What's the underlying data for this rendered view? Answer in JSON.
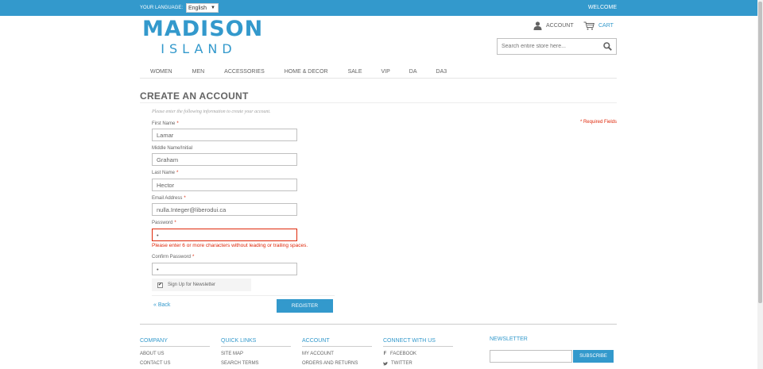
{
  "topbar": {
    "language_label": "YOUR LANGUAGE:",
    "language_value": "English",
    "welcome": "WELCOME"
  },
  "logo": {
    "line1": "MADISON",
    "line2": "ISLAND"
  },
  "header": {
    "account": "ACCOUNT",
    "cart": "CART",
    "search_placeholder": "Search entire store here..."
  },
  "nav": {
    "items": [
      {
        "label": "WOMEN"
      },
      {
        "label": "MEN"
      },
      {
        "label": "ACCESSORIES"
      },
      {
        "label": "HOME & DECOR"
      },
      {
        "label": "SALE"
      },
      {
        "label": "VIP"
      },
      {
        "label": "DA"
      },
      {
        "label": "DA3"
      }
    ]
  },
  "form": {
    "title": "CREATE AN ACCOUNT",
    "intro": "Please enter the following information to create your account.",
    "required_note": "* Required Fields",
    "required_mark": "*",
    "fields": {
      "first_name": {
        "label": "First Name",
        "value": "Lamar"
      },
      "middle_name": {
        "label": "Middle Name/Initial",
        "value": "Graham"
      },
      "last_name": {
        "label": "Last Name",
        "value": "Hector"
      },
      "email": {
        "label": "Email Address",
        "value": "nulla.Integer@liberodui.ca"
      },
      "password": {
        "label": "Password",
        "value": "•"
      },
      "confirm_password": {
        "label": "Confirm Password",
        "value": "•"
      }
    },
    "password_error": "Please enter 6 or more characters without leading or trailing spaces.",
    "newsletter_label": "Sign Up for Newsletter",
    "newsletter_checked": true,
    "back_label": "« Back",
    "register_label": "REGISTER"
  },
  "footer": {
    "company": {
      "title": "COMPANY",
      "links": [
        "ABOUT US",
        "CONTACT US"
      ]
    },
    "quick_links": {
      "title": "QUICK LINKS",
      "links": [
        "SITE MAP",
        "SEARCH TERMS"
      ]
    },
    "account": {
      "title": "ACCOUNT",
      "links": [
        "MY ACCOUNT",
        "ORDERS AND RETURNS"
      ]
    },
    "connect": {
      "title": "CONNECT WITH US",
      "links": [
        "FACEBOOK",
        "TWITTER"
      ]
    },
    "newsletter": {
      "title": "NEWSLETTER",
      "subscribe": "SUBSCRIBE"
    }
  },
  "colors": {
    "brand": "#3399cc",
    "error": "#df280a",
    "text": "#636363"
  }
}
